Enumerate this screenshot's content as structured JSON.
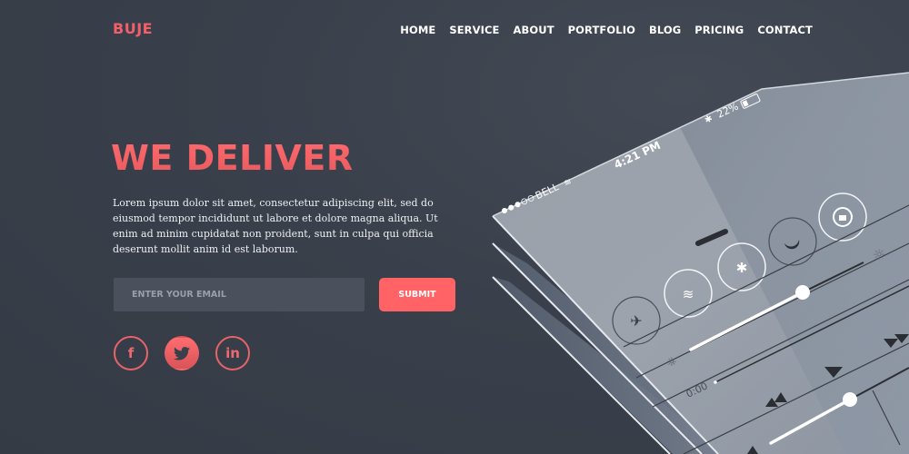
{
  "brand": {
    "logo": "BUJE",
    "accent_color": "#ff6366"
  },
  "nav": {
    "items": [
      {
        "label": "HOME"
      },
      {
        "label": "SERVICE"
      },
      {
        "label": "ABOUT"
      },
      {
        "label": "PORTFOLIO"
      },
      {
        "label": "BLOG"
      },
      {
        "label": "PRICING"
      },
      {
        "label": "CONTACT"
      }
    ]
  },
  "hero": {
    "title": "WE DELIVER",
    "text": "Lorem ipsum dolor sit amet, consectetur adipiscing elit, sed do eiusmod tempor incididunt ut labore et dolore magna aliqua. Ut enim ad minim cupidatat non proident, sunt in culpa qui officia deserunt mollit anim id est laborum."
  },
  "subscribe": {
    "email_placeholder": "ENTER YOUR EMAIL",
    "email_value": "",
    "submit_label": "SUBMIT"
  },
  "social": [
    {
      "name": "facebook",
      "glyph": "f"
    },
    {
      "name": "twitter",
      "glyph": "🐦"
    },
    {
      "name": "linkedin",
      "glyph": "in"
    }
  ],
  "phone": {
    "carrier": "BELL",
    "time": "4:21 PM",
    "battery": "22%",
    "timer": "0:00",
    "brightness_level": 0.75,
    "volume_level": 0.7,
    "toggles": [
      "airplane-icon",
      "wifi-icon",
      "bluetooth-icon",
      "moon-icon",
      "rotation-lock-icon"
    ]
  }
}
